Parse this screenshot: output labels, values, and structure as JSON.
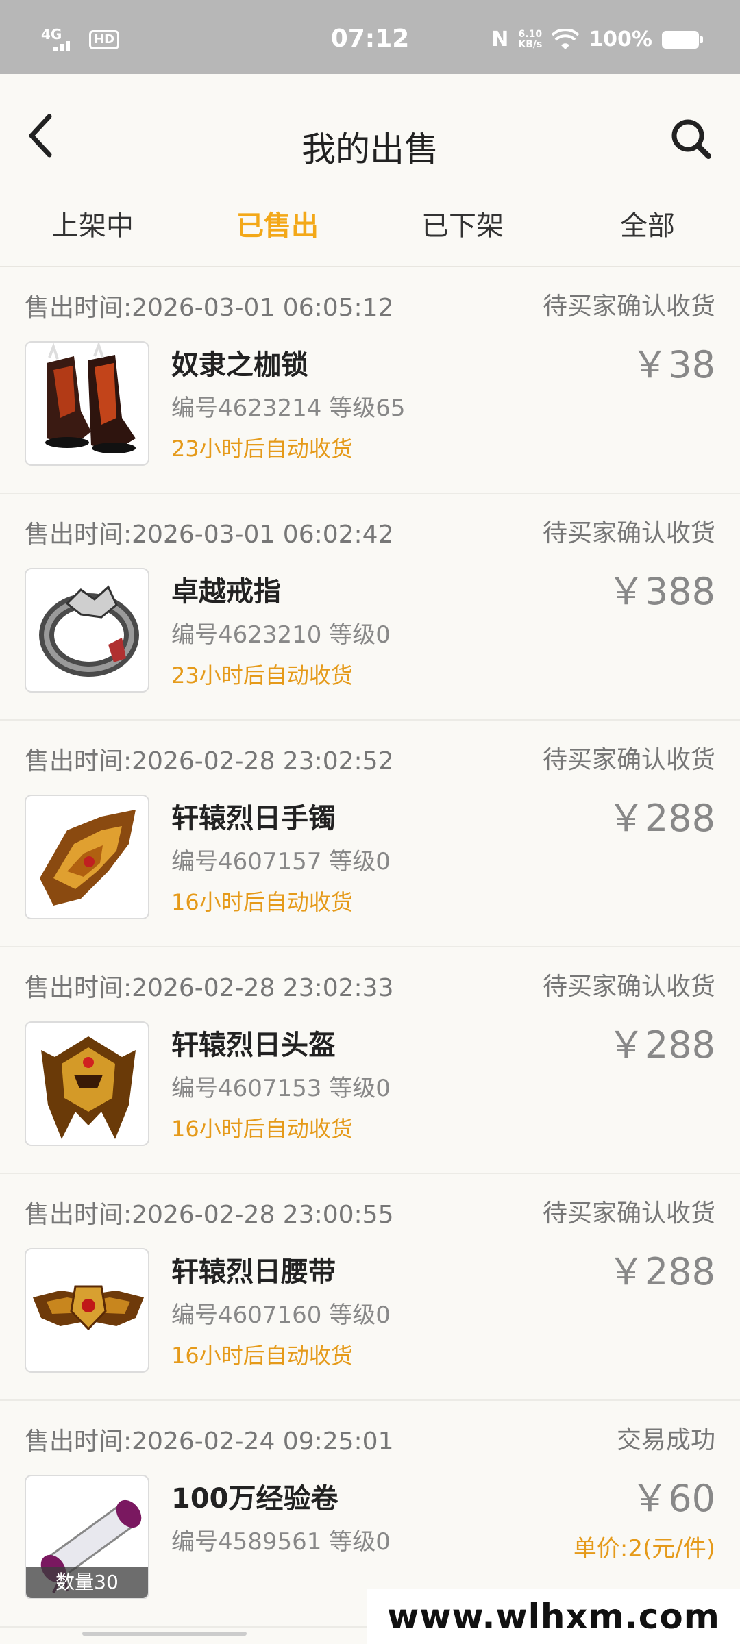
{
  "status_bar": {
    "network": "4G",
    "hd": "HD",
    "time": "07:12",
    "nfc": "N",
    "net_speed_value": "6.10",
    "net_speed_unit": "KB/s",
    "battery": "100%"
  },
  "header": {
    "title": "我的出售"
  },
  "tabs": [
    {
      "label": "上架中"
    },
    {
      "label": "已售出"
    },
    {
      "label": "已下架"
    },
    {
      "label": "全部"
    }
  ],
  "active_tab": "已售出",
  "orders": [
    {
      "sold_time": "售出时间:2026-03-01 06:05:12",
      "status": "待买家确认收货",
      "name": "奴隶之枷锁",
      "meta": "编号4623214 等级65",
      "auto_receive": "23小时后自动收货",
      "price": "￥38",
      "icon": "boots-icon"
    },
    {
      "sold_time": "售出时间:2026-03-01 06:02:42",
      "status": "待买家确认收货",
      "name": "卓越戒指",
      "meta": "编号4623210 等级0",
      "auto_receive": "23小时后自动收货",
      "price": "￥388",
      "icon": "ring-icon"
    },
    {
      "sold_time": "售出时间:2026-02-28 23:02:52",
      "status": "待买家确认收货",
      "name": "轩辕烈日手镯",
      "meta": "编号4607157 等级0",
      "auto_receive": "16小时后自动收货",
      "price": "￥288",
      "icon": "bracelet-icon"
    },
    {
      "sold_time": "售出时间:2026-02-28 23:02:33",
      "status": "待买家确认收货",
      "name": "轩辕烈日头盔",
      "meta": "编号4607153 等级0",
      "auto_receive": "16小时后自动收货",
      "price": "￥288",
      "icon": "helmet-icon"
    },
    {
      "sold_time": "售出时间:2026-02-28 23:00:55",
      "status": "待买家确认收货",
      "name": "轩辕烈日腰带",
      "meta": "编号4607160 等级0",
      "auto_receive": "16小时后自动收货",
      "price": "￥288",
      "icon": "belt-icon"
    },
    {
      "sold_time": "售出时间:2026-02-24 09:25:01",
      "status": "交易成功",
      "name": "100万经验卷",
      "meta": "编号4589561 等级0",
      "price": "￥60",
      "unit_price": "单价:2(元/件)",
      "quantity": "数量30",
      "icon": "scroll-icon"
    }
  ],
  "watermark": "www.wlhxm.com",
  "colors": {
    "accent": "#f3a818",
    "auto_receive": "#e59a1a",
    "status_bar": "#b7b7b7",
    "background": "#faf9f5"
  }
}
